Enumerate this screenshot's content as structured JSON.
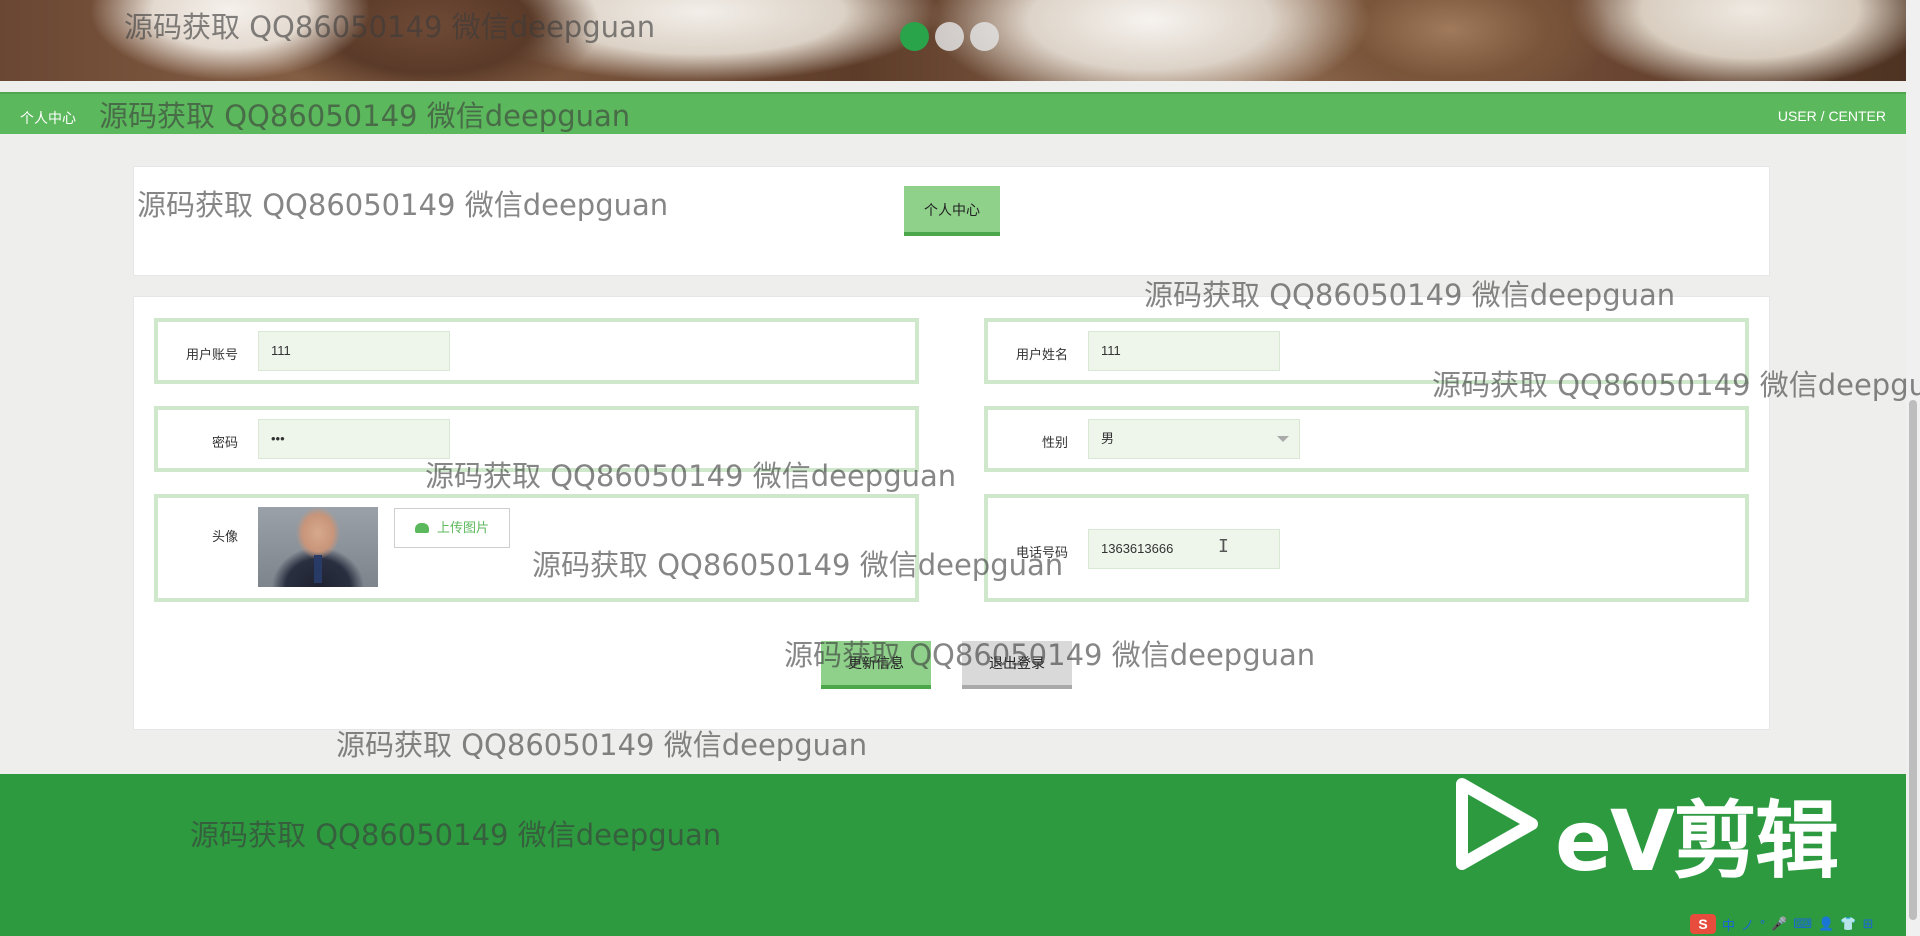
{
  "banner": {
    "slides": [
      {
        "state": "active"
      },
      {
        "state": "inactive"
      },
      {
        "state": "inactive"
      }
    ]
  },
  "nav": {
    "left_label": "个人中心",
    "right_label": "USER / CENTER"
  },
  "title_card": {
    "button_label": "个人中心"
  },
  "form": {
    "account": {
      "label": "用户账号",
      "value": "111"
    },
    "name": {
      "label": "用户姓名",
      "value": "111"
    },
    "password": {
      "label": "密码",
      "value": "•••"
    },
    "gender": {
      "label": "性别",
      "value": "男"
    },
    "avatar": {
      "label": "头像",
      "upload_label": "上传图片"
    },
    "phone": {
      "label": "电话号码",
      "value": "1363613666"
    }
  },
  "actions": {
    "update_label": "更新信息",
    "logout_label": "退出登录"
  },
  "footer": {
    "logo_text": "eV剪辑"
  },
  "tray": {
    "items": [
      "中",
      "ノ",
      "°",
      "🎤",
      "⌨",
      "👤",
      "👕",
      "⊞"
    ]
  },
  "watermark": {
    "text": "源码获取 QQ86050149 微信deepguan"
  },
  "colors": {
    "primary_green": "#5cb85c",
    "footer_green": "#2e9a40",
    "field_border": "#cfe8cc",
    "input_bg": "#eef6ec",
    "active_dot": "#2aa44a"
  }
}
